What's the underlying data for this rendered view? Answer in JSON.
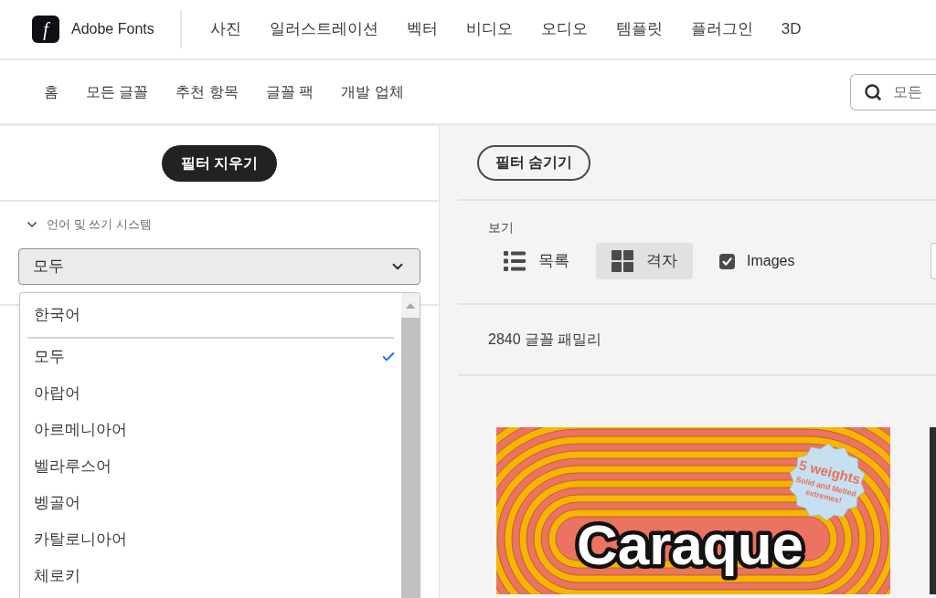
{
  "header": {
    "logo": {
      "mark": "f",
      "name": "Adobe Fonts"
    },
    "nav": [
      "사진",
      "일러스트레이션",
      "벡터",
      "비디오",
      "오디오",
      "템플릿",
      "플러그인",
      "3D"
    ]
  },
  "subnav": {
    "items": [
      "홈",
      "모든 글꼴",
      "추천 항목",
      "글꼴 팩",
      "개발 업체"
    ],
    "search": {
      "placeholder": "모든"
    }
  },
  "filters": {
    "clear_button": "필터 지우기",
    "section": {
      "title": "언어 및 쓰기 시스템",
      "expanded": true
    },
    "select": {
      "value": "모두",
      "open": true
    },
    "options": [
      {
        "label": "한국어",
        "kind": "pinned",
        "selected": false
      },
      {
        "label": "모두",
        "kind": "option",
        "selected": true
      },
      {
        "label": "아랍어",
        "kind": "option",
        "selected": false
      },
      {
        "label": "아르메니아어",
        "kind": "option",
        "selected": false
      },
      {
        "label": "벨라루스어",
        "kind": "option",
        "selected": false
      },
      {
        "label": "벵골어",
        "kind": "option",
        "selected": false
      },
      {
        "label": "카탈로니아어",
        "kind": "option",
        "selected": false
      },
      {
        "label": "체로키",
        "kind": "option",
        "selected": false
      }
    ]
  },
  "results": {
    "hide_filters_button": "필터 숨기기",
    "view_label": "보기",
    "views": [
      {
        "label": "목록",
        "kind": "list",
        "selected": false
      },
      {
        "label": "격자",
        "kind": "grid",
        "selected": true
      }
    ],
    "images": {
      "label": "Images",
      "checked": true
    },
    "count": "2840 글꼴 패밀리",
    "cards": [
      {
        "kind": "specimen",
        "title": "Caraque",
        "badge": [
          "5 weights",
          "Solid and Melted",
          "extremes!"
        ]
      },
      {
        "kind": "dark"
      }
    ]
  }
}
